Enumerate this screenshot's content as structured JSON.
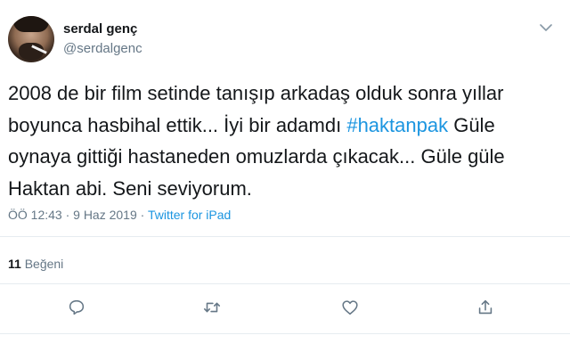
{
  "user": {
    "name": "serdal genç",
    "handle": "@serdalgenc"
  },
  "tweet": {
    "text_before": "2008 de bir film setinde tanışıp arkadaş olduk sonra yıllar\nboyunca hasbihal ettik... İyi bir adamdı ",
    "hashtag": "#haktanpak",
    "text_after": " Güle\noynaya gittiği hastaneden omuzlarda çıkacak... Güle güle\nHaktan abi. Seni seviyorum.",
    "timestamp": "ÖÖ 12:43 · 9 Haz 2019 · ",
    "source": "Twitter for iPad"
  },
  "stats": {
    "likes_count": "11",
    "likes_label": "Beğeni"
  },
  "colors": {
    "link": "#1b95e0",
    "secondary_text": "#657786",
    "divider": "#e6ecf0"
  },
  "icons": {
    "reply": "reply-icon",
    "retweet": "retweet-icon",
    "like": "like-icon",
    "share": "share-icon",
    "menu": "chevron-down-icon"
  }
}
